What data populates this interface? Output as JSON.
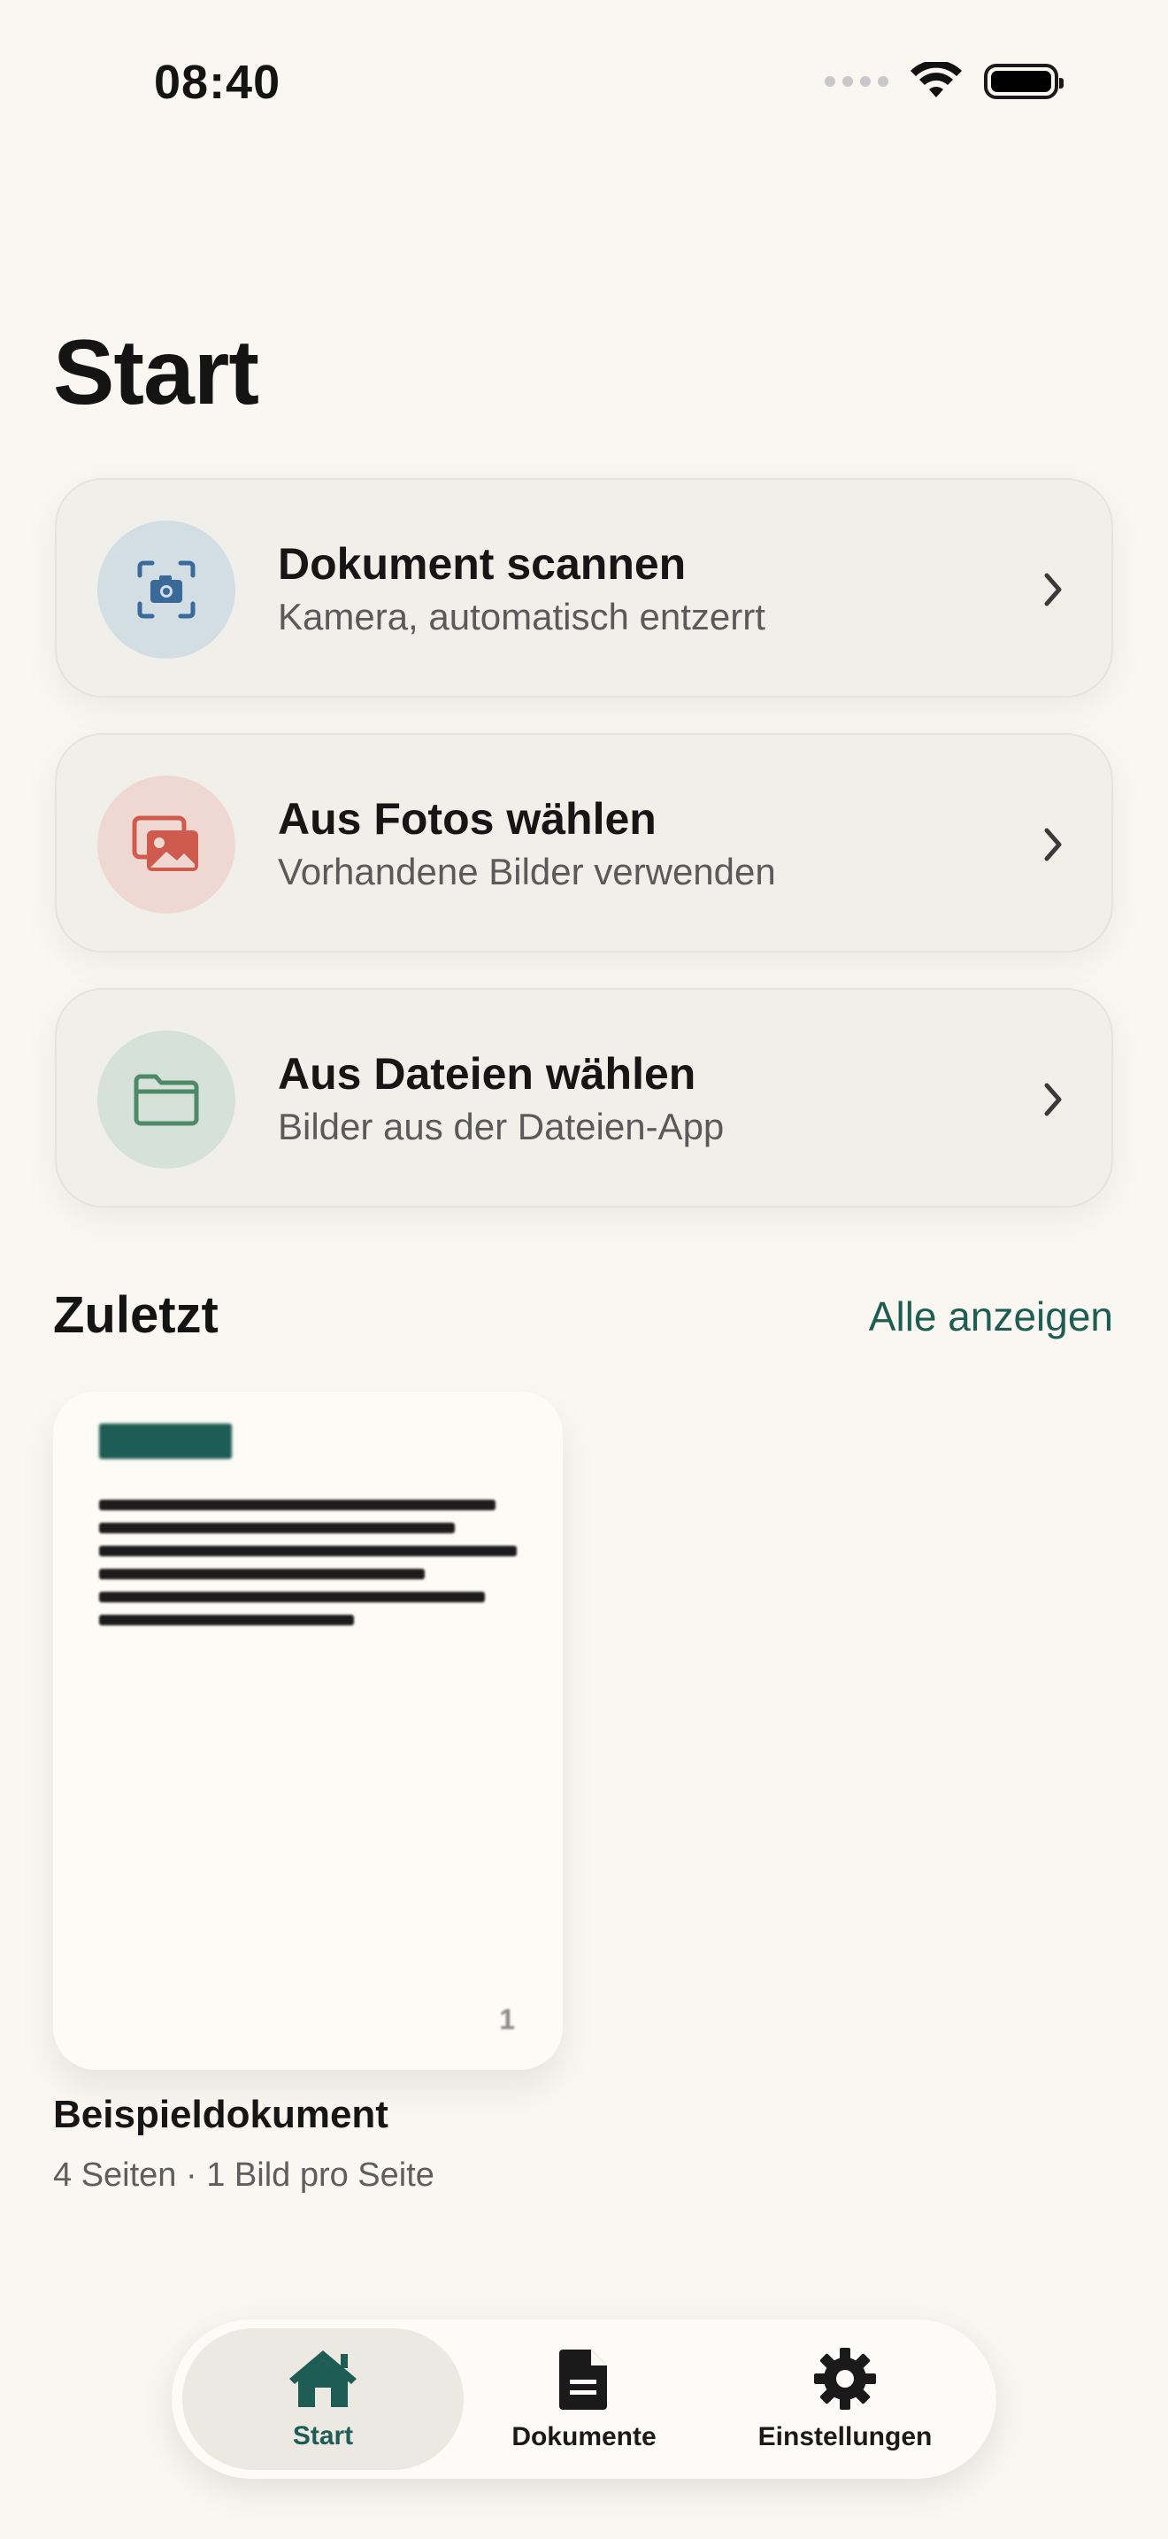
{
  "status_bar": {
    "time": "08:40"
  },
  "page": {
    "title": "Start"
  },
  "actions": [
    {
      "title": "Dokument scannen",
      "subtitle": "Kamera, automatisch entzerrt",
      "icon": "camera-scan-icon",
      "icon_color": "#3a6a9a",
      "circle_color": "#d3dde4"
    },
    {
      "title": "Aus Fotos wählen",
      "subtitle": "Vorhandene Bilder verwenden",
      "icon": "photos-icon",
      "icon_color": "#cf5a4e",
      "circle_color": "#efd8d2"
    },
    {
      "title": "Aus Dateien wählen",
      "subtitle": "Bilder aus der Dateien-App",
      "icon": "folder-icon",
      "icon_color": "#4f8a68",
      "circle_color": "#d6e1da"
    }
  ],
  "recent": {
    "title": "Zuletzt",
    "see_all": "Alle anzeigen",
    "items": [
      {
        "name": "Beispieldokument",
        "meta": "4 Seiten · 1 Bild pro Seite",
        "page_number": "1"
      }
    ]
  },
  "tabs": [
    {
      "label": "Start",
      "icon": "house-icon",
      "active": true
    },
    {
      "label": "Dokumente",
      "icon": "document-icon",
      "active": false
    },
    {
      "label": "Einstellungen",
      "icon": "gear-icon",
      "active": false
    }
  ],
  "colors": {
    "accent": "#1d5d55",
    "background": "#faf7f2"
  }
}
